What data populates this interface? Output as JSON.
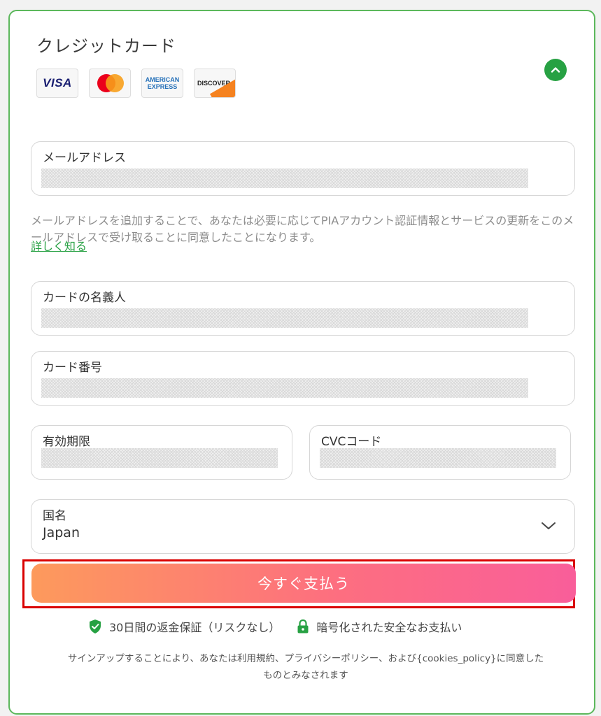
{
  "section": {
    "title": "クレジットカード"
  },
  "brands": [
    {
      "name": "visa",
      "label": "VISA"
    },
    {
      "name": "mastercard",
      "label": ""
    },
    {
      "name": "amex",
      "label": "AMERICAN EXPRESS"
    },
    {
      "name": "discover",
      "label": "DISCOVER"
    }
  ],
  "colors": {
    "accent": "#27a143",
    "border": "#5cb85c",
    "highlight": "#d90000",
    "gradient_start": "#fd9a5c",
    "gradient_end": "#f95e9a"
  },
  "email": {
    "label": "メールアドレス",
    "helper": "メールアドレスを追加することで、あなたは必要に応じてPIAアカウント認証情報とサービスの更新をこのメールアドレスで受け取ることに同意したことになります。",
    "learn_more": "詳しく知る"
  },
  "cardholder": {
    "label": "カードの名義人"
  },
  "card_number": {
    "label": "カード番号"
  },
  "expiry": {
    "label": "有効期限"
  },
  "cvc": {
    "label": "CVCコード"
  },
  "country": {
    "label": "国名",
    "value": "Japan"
  },
  "pay_button": {
    "label": "今すぐ支払う"
  },
  "guarantee": {
    "refund": "30日間の返金保証（リスクなし）",
    "secure": "暗号化された安全なお支払い"
  },
  "terms": {
    "line1": "サインアップすることにより、あなたは利用規約、プライバシーポリシー、および{cookies_policy}に同意した",
    "line2": "ものとみなされます"
  },
  "icons": {
    "collapse": "chevron-up-icon",
    "select": "chevron-down-icon",
    "refund": "shield-check-icon",
    "secure": "lock-icon"
  }
}
